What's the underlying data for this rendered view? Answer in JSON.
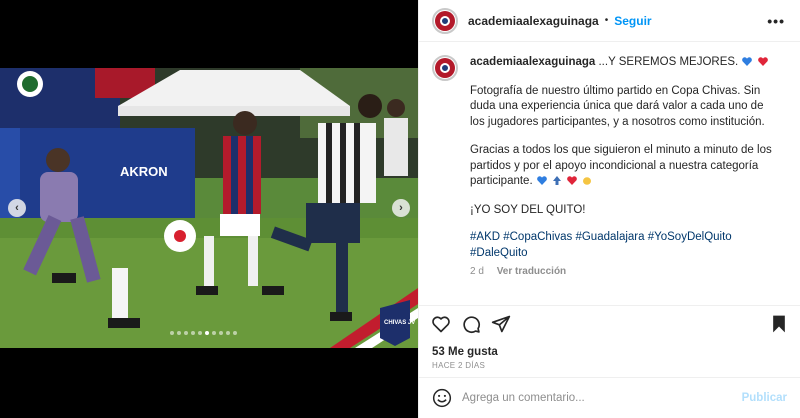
{
  "post": {
    "username": "academiaalexaguinaga",
    "follow_label": "Seguir",
    "separator": "•",
    "more_label": "•••",
    "caption": {
      "username": "academiaalexaguinaga",
      "line1": " ...Y SEREMOS MEJORES.",
      "para1": "Fotografía de nuestro último partido en Copa Chivas. Sin duda una experiencia única que dará valor a cada uno de los jugadores participantes, y a nosotros como institución.",
      "para2": "Gracias a todos los que siguieron el minuto a minuto de los partidos y por el apoyo incondicional a nuestra categoría participante.",
      "para3": "¡YO SOY DEL QUITO!",
      "hashtags": "#AKD #CopaChivas #Guadalajara #YoSoyDelQuito #DaleQuito",
      "time": "2 d",
      "translate": "Ver traducción"
    },
    "likes": "53 Me gusta",
    "posted_ago": "HACE 2 DÍAS",
    "comment": {
      "placeholder": "Agrega un comentario...",
      "publish_label": "Publicar"
    }
  },
  "media": {
    "prev_label": "‹",
    "next_label": "›",
    "slide_count": 10,
    "active_slide": 6,
    "banner_text": "AKRON",
    "badge_text": "CHIVAS JV"
  },
  "colors": {
    "link": "#0095f6",
    "hashtag": "#00376b",
    "muted": "#8e8e8e"
  },
  "icons": [
    "heart-icon",
    "comment-icon",
    "share-icon",
    "bookmark-icon",
    "emoji-icon",
    "more-icon"
  ]
}
